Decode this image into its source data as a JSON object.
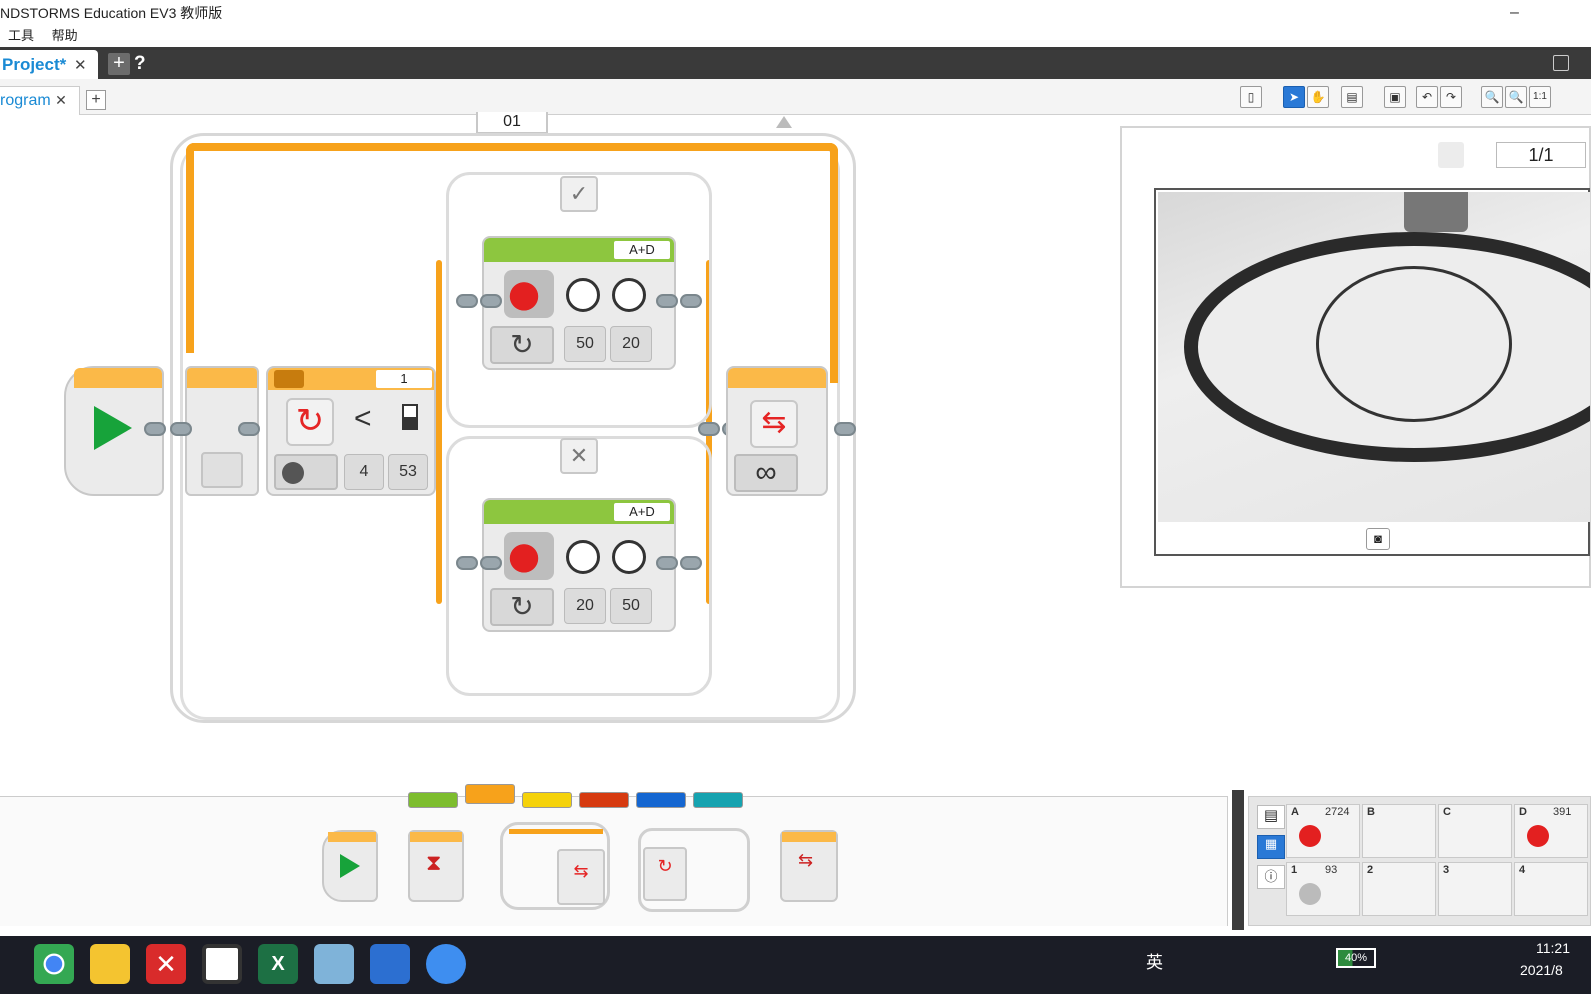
{
  "window": {
    "title": "NDSTORMS Education EV3 教师版",
    "minimize_label": "–"
  },
  "menu": {
    "items": [
      "工具",
      "帮助"
    ]
  },
  "project_tabs": {
    "active_label": "Project*",
    "close_label": "✕",
    "add_label": "+",
    "help_label": "?"
  },
  "program_tabs": {
    "active_label": "rogram",
    "close_label": "✕",
    "add_label": "+"
  },
  "toolbar": {
    "zoom_reset_label": "1:1"
  },
  "program": {
    "loop_name": "01",
    "switch_port": "1",
    "compare_operator": "<",
    "compare_inputs": [
      "4",
      "53"
    ],
    "motor_true": {
      "ports": "A+D",
      "power_left": "50",
      "power_right": "20"
    },
    "motor_false": {
      "ports": "A+D",
      "power_left": "20",
      "power_right": "50"
    },
    "loop_end_symbol": "∞",
    "true_icon": "✓",
    "false_icon": "✕"
  },
  "content_editor": {
    "page_counter": "1/1"
  },
  "palette": {
    "categories": [
      {
        "name": "action",
        "color": "#7dbd2e"
      },
      {
        "name": "flow",
        "color": "#f7a21b"
      },
      {
        "name": "sensor",
        "color": "#f5d20a"
      },
      {
        "name": "data",
        "color": "#d63a10"
      },
      {
        "name": "advanced",
        "color": "#1466d1"
      },
      {
        "name": "myblocks",
        "color": "#16a3b0"
      }
    ]
  },
  "port_view": {
    "motor_ports": [
      {
        "label": "A",
        "value": "2724"
      },
      {
        "label": "B",
        "value": ""
      },
      {
        "label": "C",
        "value": ""
      },
      {
        "label": "D",
        "value": "391"
      }
    ],
    "sensor_ports": [
      {
        "label": "1",
        "value": "93"
      },
      {
        "label": "2",
        "value": ""
      },
      {
        "label": "3",
        "value": ""
      },
      {
        "label": "4",
        "value": ""
      }
    ]
  },
  "taskbar": {
    "tray_text": "英",
    "battery": "40%",
    "time": "11:21",
    "date": "2021/8"
  },
  "colors": {
    "flow_orange": "#f7a21b",
    "action_green": "#8dc63f",
    "accent_blue": "#1a8ad4",
    "taskbar": "#1b1d26"
  }
}
